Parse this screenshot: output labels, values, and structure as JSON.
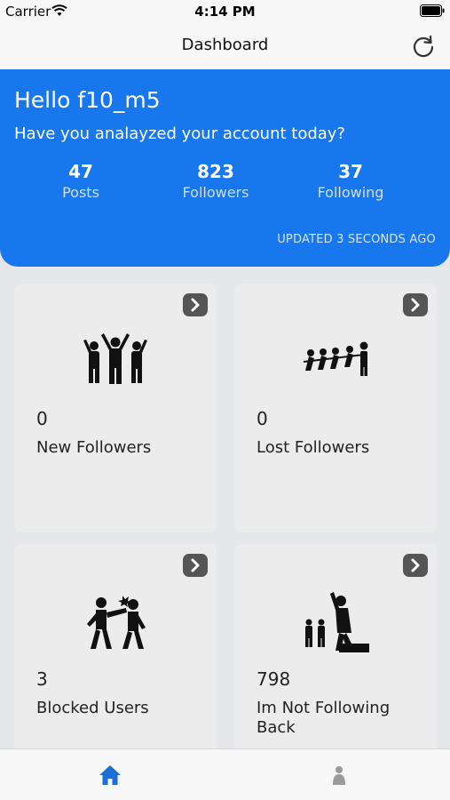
{
  "status_bar": {
    "carrier": "Carrier",
    "time": "4:14 PM"
  },
  "nav": {
    "title": "Dashboard"
  },
  "hero": {
    "greeting": "Hello f10_m5",
    "subtitle": "Have you analayzed your account today?",
    "stats": [
      {
        "value": "47",
        "label": "Posts"
      },
      {
        "value": "823",
        "label": "Followers"
      },
      {
        "value": "37",
        "label": "Following"
      }
    ],
    "updated": "UPDATED 3 SECONDS AGO"
  },
  "cards": [
    {
      "value": "0",
      "label": "New Followers",
      "icon": "cheering-group-icon"
    },
    {
      "value": "0",
      "label": "Lost Followers",
      "icon": "tug-of-war-icon"
    },
    {
      "value": "3",
      "label": "Blocked Users",
      "icon": "punch-fight-icon"
    },
    {
      "value": "798",
      "label": "Im Not Following Back",
      "icon": "podium-winner-icon"
    }
  ],
  "tabs": [
    {
      "name": "home",
      "icon": "home-icon",
      "active": true
    },
    {
      "name": "profile",
      "icon": "person-icon",
      "active": false
    }
  ],
  "colors": {
    "accent": "#1877ed",
    "tab_active": "#1a6ed8",
    "tab_inactive": "#9a9a9a"
  }
}
